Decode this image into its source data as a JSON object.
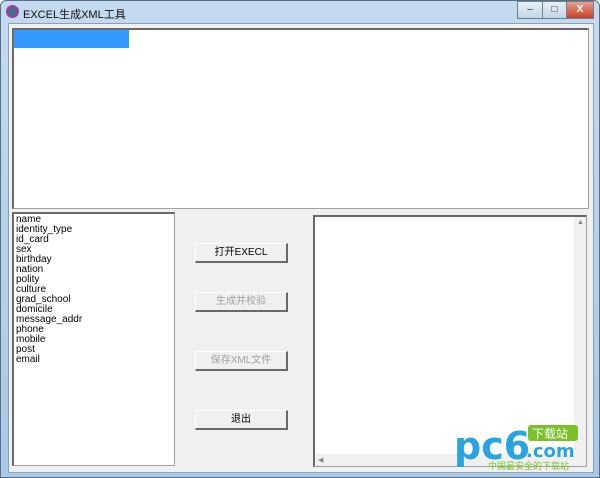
{
  "window": {
    "title": "EXCEL生成XML工具",
    "minimize": "–",
    "maximize": "□",
    "close": "X"
  },
  "fields": [
    "name",
    "identity_type",
    "id_card",
    "sex",
    "birthday",
    "nation",
    "polity",
    "culture",
    "grad_school",
    "domicile",
    "message_addr",
    "phone",
    "mobile",
    "post",
    "email"
  ],
  "buttons": {
    "open": "打开EXECL",
    "generate": "生成并校验",
    "save": "保存XML文件",
    "exit": "退出"
  },
  "watermark": {
    "brand": "pc6",
    "domain": ".com",
    "badge": "下载站",
    "slogan": "中国最安全的下载站"
  },
  "colors": {
    "selection": "#3399ff",
    "logo_blue": "#2aa3e0",
    "logo_green": "#7bbf2a"
  }
}
